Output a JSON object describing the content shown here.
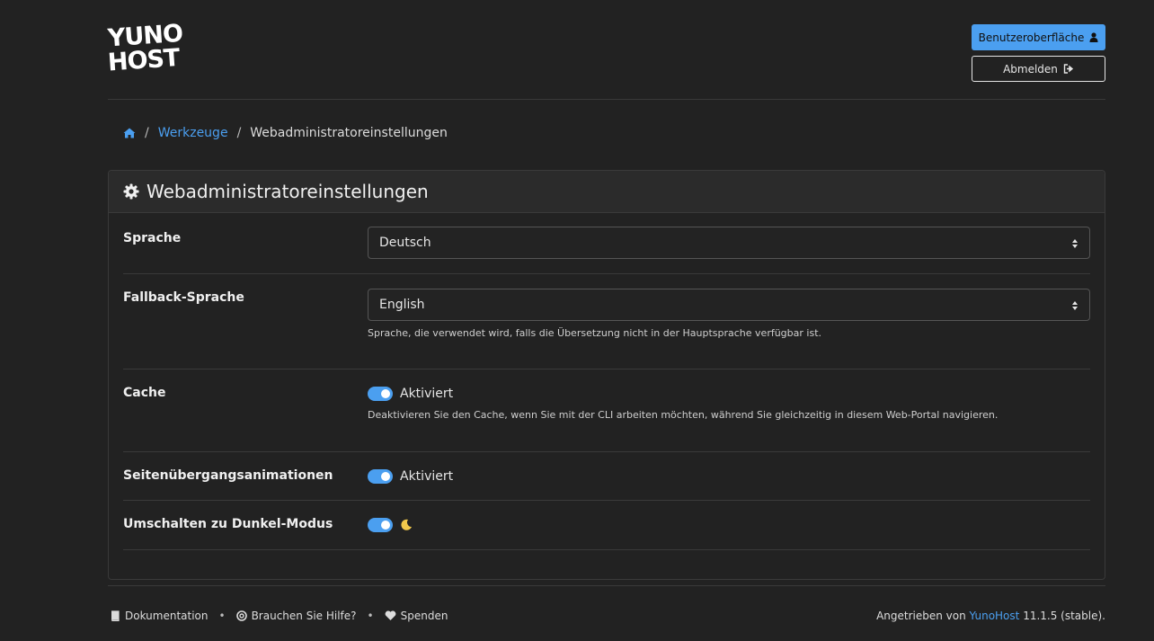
{
  "header": {
    "logo_line1": "YUNO",
    "logo_line2": "HOST",
    "user_button": "Benutzeroberfläche",
    "logout_button": "Abmelden"
  },
  "breadcrumb": {
    "home_icon": "home-icon",
    "tools": "Werkzeuge",
    "current": "Webadministratoreinstellungen"
  },
  "card": {
    "title": "Webadministratoreinstellungen",
    "title_icon": "gear-icon"
  },
  "settings": {
    "language": {
      "label": "Sprache",
      "value": "Deutsch"
    },
    "fallback": {
      "label": "Fallback-Sprache",
      "value": "English",
      "help": "Sprache, die verwendet wird, falls die Übersetzung nicht in der Hauptsprache verfügbar ist."
    },
    "cache": {
      "label": "Cache",
      "state": "Aktiviert",
      "help": "Deaktivieren Sie den Cache, wenn Sie mit der CLI arbeiten möchten, während Sie gleichzeitig in diesem Web-Portal navigieren."
    },
    "transitions": {
      "label": "Seitenübergangsanimationen",
      "state": "Aktiviert"
    },
    "dark_mode": {
      "label": "Umschalten zu Dunkel-Modus",
      "icon": "moon-icon"
    }
  },
  "footer": {
    "docs": "Dokumentation",
    "help": "Brauchen Sie Hilfe?",
    "donate": "Spenden",
    "powered_prefix": "Angetrieben von",
    "powered_link": "YunoHost",
    "powered_suffix": "11.1.5 (stable)."
  },
  "colors": {
    "background": "#222222",
    "accent": "#4b9ff0",
    "border": "#3a3a3a"
  }
}
